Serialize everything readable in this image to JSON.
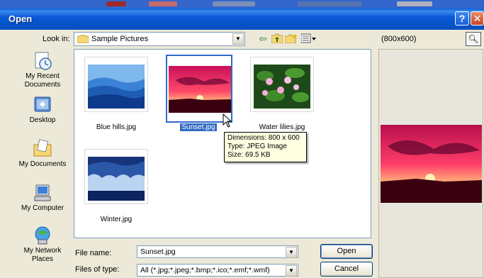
{
  "window": {
    "title": "Open"
  },
  "toolbar": {
    "look_in_label": "Look in:",
    "look_in_value": "Sample Pictures",
    "tools": [
      "back-icon",
      "up-folder-icon",
      "new-folder-icon",
      "views-menu-icon"
    ]
  },
  "places": [
    {
      "label": "My Recent Documents",
      "icon": "recent-documents-icon"
    },
    {
      "label": "Desktop",
      "icon": "desktop-icon"
    },
    {
      "label": "My Documents",
      "icon": "my-documents-icon"
    },
    {
      "label": "My Computer",
      "icon": "my-computer-icon"
    },
    {
      "label": "My Network Places",
      "icon": "network-places-icon"
    }
  ],
  "files": [
    {
      "name": "Blue hills.jpg"
    },
    {
      "name": "Sunset.jpg",
      "selected": true
    },
    {
      "name": "Water lilies.jpg"
    },
    {
      "name": "Winter.jpg"
    }
  ],
  "tooltip": {
    "dimensions": "Dimensions: 800 x 600",
    "type": "Type: JPEG Image",
    "size": "Size: 69.5 KB"
  },
  "preview": {
    "dimensions": "(800x600)"
  },
  "form": {
    "file_name_label": "File name:",
    "file_name_value": "Sunset.jpg",
    "file_type_label": "Files of type:",
    "file_type_value": "All (*.jpg;*.jpeg;*.bmp;*.ico;*.emf;*.wmf)",
    "open_label": "Open",
    "cancel_label": "Cancel"
  },
  "colors": {
    "titlebar": "#0a58d6",
    "selection": "#316ac5",
    "tooltip_bg": "#ffffe1",
    "dialog_bg": "#ece9d8"
  }
}
